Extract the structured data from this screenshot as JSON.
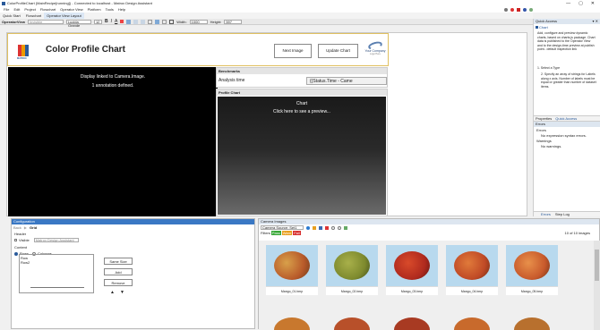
{
  "window": {
    "title": "ColorProfileChart (MainRecipe[running]) - Connected to localhost - Matrox Design Assistant",
    "controls": {
      "minimize": "—",
      "maximize": "▢",
      "close": "✕"
    }
  },
  "menu": [
    "File",
    "Edit",
    "Project",
    "Flowchart",
    "Operator View",
    "Platform",
    "Tools",
    "Help"
  ],
  "tabs": [
    "Quick Start",
    "Flowchart",
    "Operator View Layout"
  ],
  "toolbar": {
    "view_label": "OperatorView",
    "view_value": "Invisible",
    "font_value": "Lucida Grande",
    "font_size": "12",
    "width_label": "Width:",
    "width_value": "1000",
    "height_label": "Height:",
    "height_value": "597"
  },
  "canvas": {
    "header_title": "Color Profile Chart",
    "logo_text": "MATROX",
    "next_image": "Next Image",
    "update_chart": "Update Chart",
    "company_text": "Your Company",
    "company_sub": "Logo Here",
    "display_line1": "Display linked to Camera.Image.",
    "display_line2": "1 annotation defined.",
    "benchmarks_label": "Benchmarks",
    "analysis_label": "Analysis time",
    "analysis_value": "{{Status.Time - Came",
    "profile_label": "Profile Chart",
    "chart_title": "Chart",
    "chart_hint": "Click here to see a preview..."
  },
  "quick_access": {
    "title": "Quick Access",
    "pin": "▾ ✕",
    "chart_item": "Chart",
    "description": "Add, configure and preview dynamic charts, based on charts.js package. Chart data is published to the Operator View and to the design-time preview at publish point.. default inspection link",
    "steps": [
      "1.  Select a Type",
      "2.  Specify an array of strings for Labels along x axis. Number of labels must be equal or greater than number of dataset items."
    ],
    "tabs": [
      "Properties",
      "Quick Access"
    ]
  },
  "errors": {
    "title": "Errors",
    "items": [
      "Errors",
      "No expression syntax errors.",
      "Warnings",
      "No warnings."
    ],
    "tabs": [
      "Errors",
      "Step Log"
    ]
  },
  "configuration": {
    "title": "Configuration",
    "back": "Back",
    "grid_label": "Grid",
    "header_label": "Header",
    "visible_label": "Visible",
    "header_value": "Matrox Design Assistant",
    "content_label": "Content",
    "rows_label": "Rows",
    "columns_label": "Columns",
    "list_items": [
      "Row",
      "Row2"
    ],
    "same_size": "Same Size",
    "add": "Add",
    "remove": "Remove"
  },
  "camera_images": {
    "title": "Camera Images",
    "source_label": "Camera Source: Set1",
    "filters_label": "Filters",
    "filter_tags": [
      "Pass",
      "Warn",
      "Fail"
    ],
    "count": "10 of 10 images",
    "thumbs": [
      "Mango_01.bmp",
      "Mango_02.bmp",
      "Mango_03.bmp",
      "Mango_04.bmp",
      "Mango_05.bmp"
    ]
  },
  "colors": {
    "accent": "#2a5a9a",
    "dark": "#000000",
    "panel_header": "#dde6f0",
    "pass": "#38a838",
    "warn": "#e8a020",
    "fail": "#d83030",
    "mango_fill": [
      "#b85a2a",
      "#7e8a2e",
      "#b02a1e",
      "#c04a26",
      "#c85a2c"
    ]
  }
}
